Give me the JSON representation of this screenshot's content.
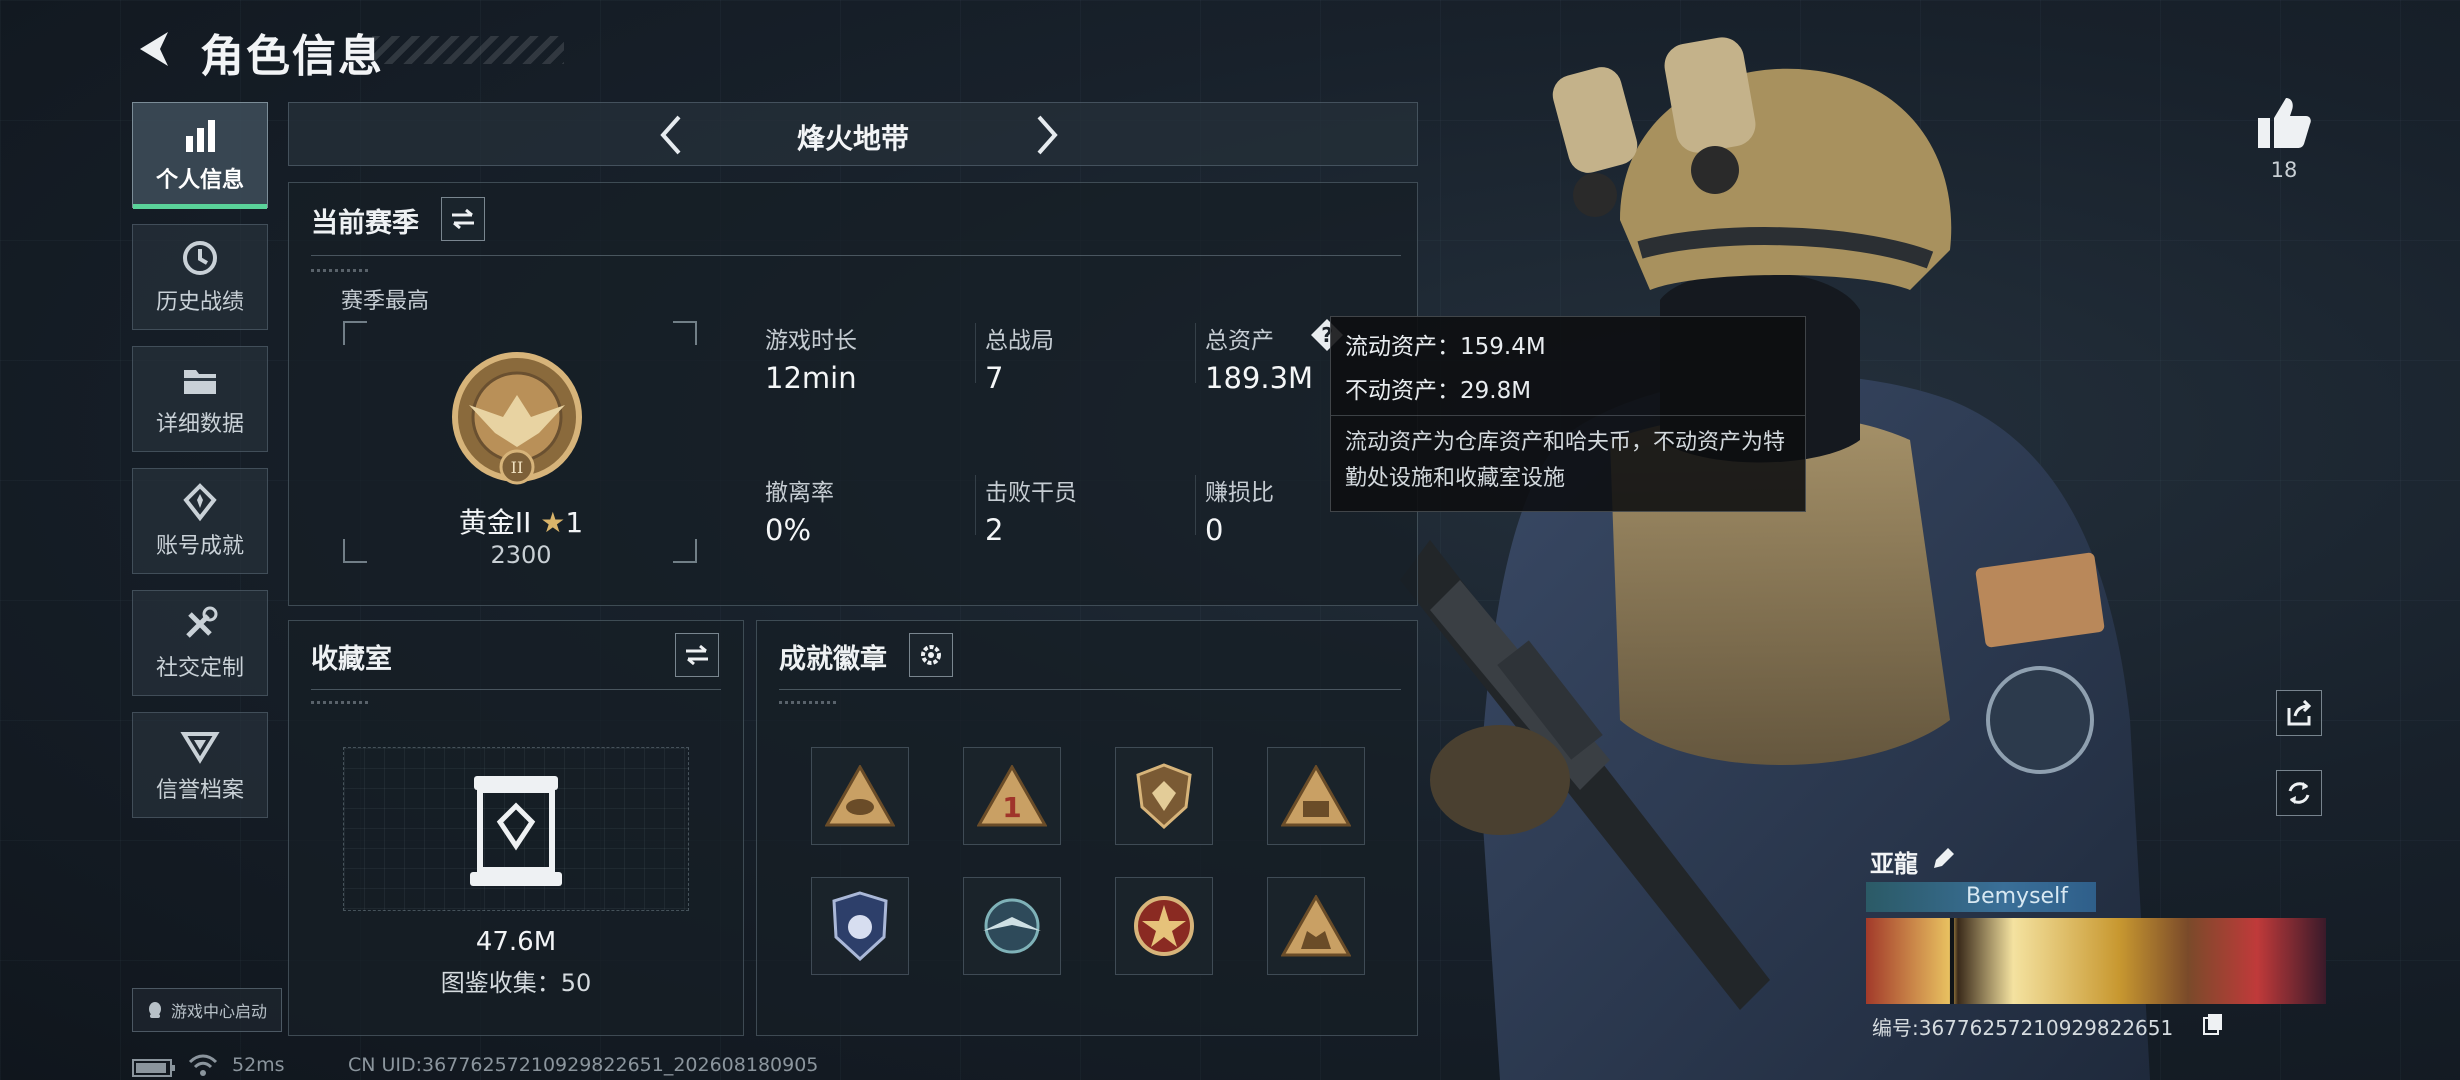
{
  "header": {
    "title": "角色信息"
  },
  "nav": {
    "items": [
      {
        "label": "个人信息",
        "icon": "bar-chart-icon"
      },
      {
        "label": "历史战绩",
        "icon": "history-icon"
      },
      {
        "label": "详细数据",
        "icon": "folder-icon"
      },
      {
        "label": "账号成就",
        "icon": "achievement-icon"
      },
      {
        "label": "社交定制",
        "icon": "tools-icon"
      },
      {
        "label": "信誉档案",
        "icon": "credit-icon"
      }
    ],
    "launch_label": "游戏中心启动"
  },
  "mode": {
    "name": "烽火地带"
  },
  "season": {
    "title": "当前赛季",
    "best_label": "赛季最高",
    "rank_name": "黄金II",
    "rank_stars": "1",
    "rank_score": "2300",
    "stats": [
      {
        "label": "游戏时长",
        "value": "12min"
      },
      {
        "label": "总战局",
        "value": "7"
      },
      {
        "label": "总资产",
        "value": "189.3M"
      },
      {
        "label": "撤离率",
        "value": "0%"
      },
      {
        "label": "击败干员",
        "value": "2"
      },
      {
        "label": "赚损比",
        "value": "0"
      }
    ]
  },
  "tooltip": {
    "liquid": "流动资产：159.4M",
    "fixed": "不动资产：29.8M",
    "desc": "流动资产为仓库资产和哈夫币，不动资产为特勤处设施和收藏室设施"
  },
  "collection": {
    "title": "收藏室",
    "value": "47.6M",
    "catalog": "图鉴收集：50"
  },
  "badges": {
    "title": "成就徽章",
    "items": [
      "tri-badge-gold",
      "tri-badge-1",
      "shield-badge",
      "tri-badge-56",
      "police-badge",
      "wing-badge",
      "star-badge",
      "tri-badge-beast"
    ]
  },
  "likes": {
    "count": "18"
  },
  "player": {
    "name": "亚龍",
    "tag": "Bemyself",
    "id": "编号:3677625721092982265​1"
  },
  "footer": {
    "ping": "52ms",
    "uid": "CN UID:36776257210929822651_202608180905"
  },
  "colors": {
    "accent": "#5ad39a",
    "badge_gold": "#c9a064",
    "panel_border": "#4f5f6b"
  }
}
